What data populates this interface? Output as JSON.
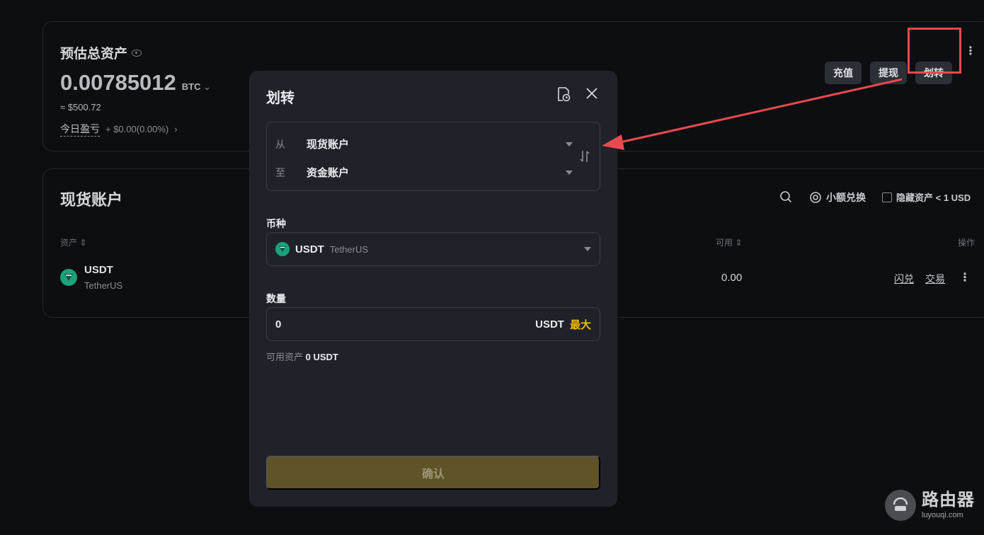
{
  "overview": {
    "title": "预估总资产",
    "value": "0.00785012",
    "unit": "BTC",
    "usd": "≈ $500.72",
    "pnl_label": "今日盈亏",
    "pnl_value": "+ $0.00(0.00%)",
    "buttons": {
      "deposit": "充值",
      "withdraw": "提现",
      "transfer": "划转"
    }
  },
  "spot": {
    "title": "现货账户",
    "tools": {
      "small_convert": "小额兑换",
      "hide_small": "隐藏资产 < 1 USD"
    },
    "headers": {
      "asset": "资产",
      "available": "可用",
      "action": "操作"
    },
    "rows": [
      {
        "symbol": "USDT",
        "name": "TetherUS",
        "available": "0.00",
        "flash": "闪兑",
        "trade": "交易"
      }
    ]
  },
  "modal": {
    "title": "划转",
    "from_label": "从",
    "from_value": "现货账户",
    "to_label": "至",
    "to_value": "资金账户",
    "coin_label": "币种",
    "coin_symbol": "USDT",
    "coin_name": "TetherUS",
    "amount_label": "数量",
    "amount_value": "0",
    "amount_unit": "USDT",
    "max_label": "最大",
    "avail_label": "可用资产",
    "avail_value": "0 USDT",
    "confirm_label": "确认"
  },
  "watermark": {
    "title": "路由器",
    "sub": "luyouqi.com"
  },
  "colors": {
    "accent": "#f0b90b",
    "annotation": "#e84a4f",
    "coin": "#1ba27a"
  }
}
